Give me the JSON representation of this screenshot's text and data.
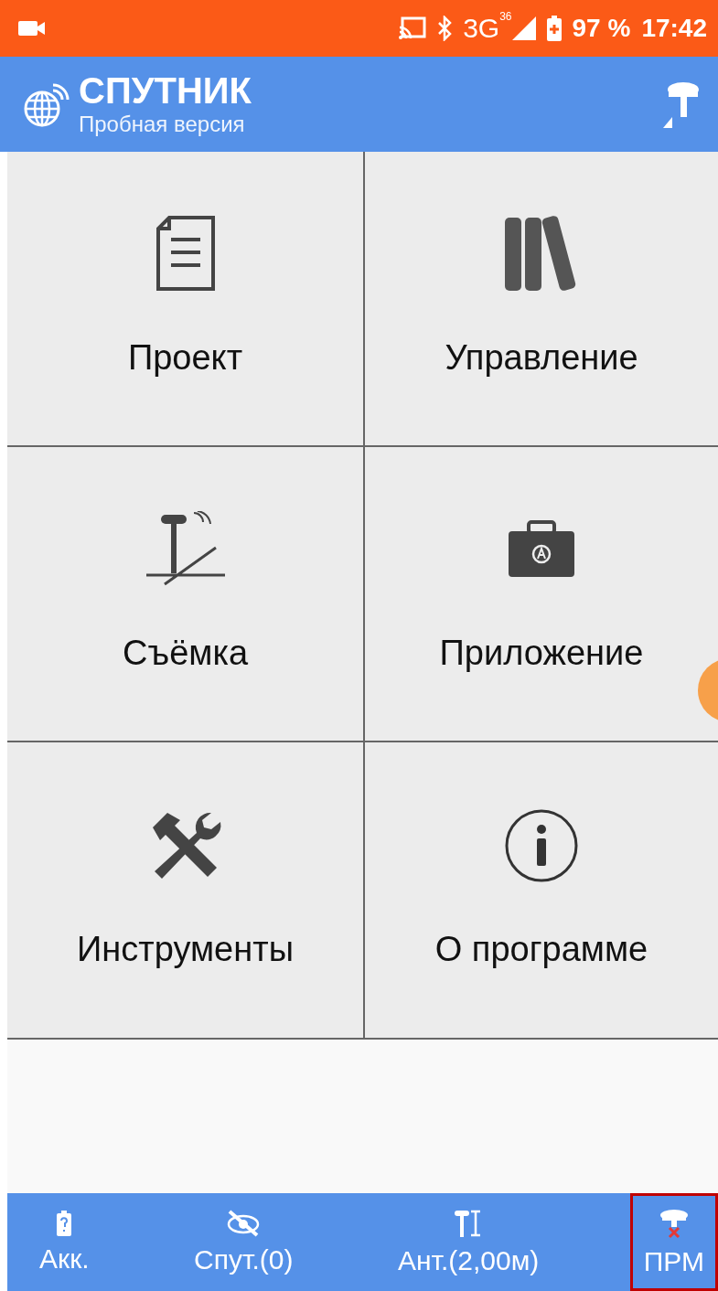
{
  "status_bar": {
    "network": "3G",
    "network_sup": "36",
    "battery": "97 %",
    "time": "17:42"
  },
  "app_bar": {
    "title": "СПУТНИК",
    "subtitle": "Пробная версия"
  },
  "tiles": [
    {
      "label": "Проект"
    },
    {
      "label": "Управление"
    },
    {
      "label": "Съёмка"
    },
    {
      "label": "Приложение"
    },
    {
      "label": "Инструменты"
    },
    {
      "label": "О программе"
    }
  ],
  "bottom_bar": [
    {
      "label": "Акк.",
      "selected": false
    },
    {
      "label": "Спут.(0)",
      "selected": false
    },
    {
      "label": "Ант.(2,00м)",
      "selected": false
    },
    {
      "label": "ПРМ",
      "selected": true
    }
  ]
}
